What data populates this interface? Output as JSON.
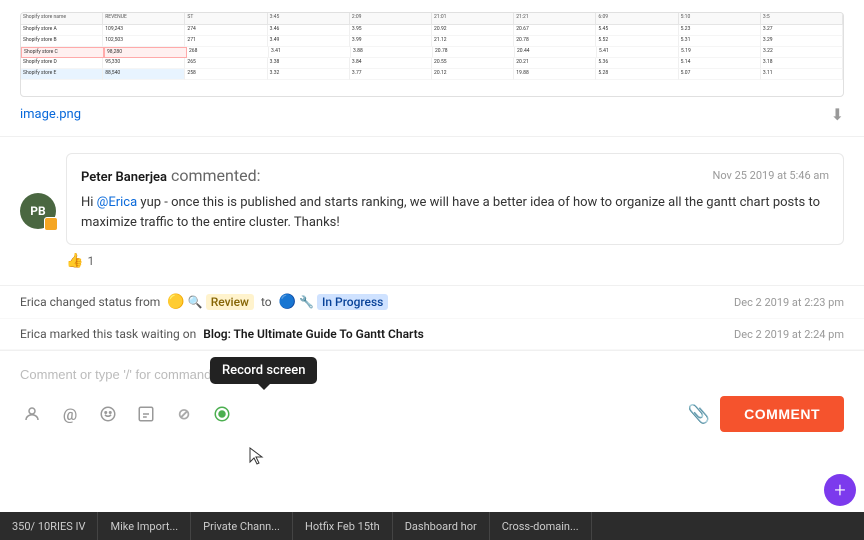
{
  "image": {
    "filename": "image.png",
    "download_label": "⬇"
  },
  "comment": {
    "author": "Peter Banerjea",
    "author_initials": "PB",
    "action": "commented:",
    "timestamp": "Nov 25 2019 at 5:46 am",
    "mention": "@Erica",
    "text_part1": "Hi ",
    "text_part2": " yup - once this is published and starts ranking, we will have a better idea of how to organize all the gantt chart posts to maximize traffic to the entire cluster. Thanks!",
    "likes": "1"
  },
  "activity": [
    {
      "text": "Erica changed status from",
      "from_badge": "Review",
      "arrow": "to",
      "to_badge": "In Progress",
      "timestamp": "Dec 2 2019 at 2:23 pm"
    },
    {
      "text": "Erica marked this task waiting on",
      "link": "Blog: The Ultimate Guide To Gantt Charts",
      "timestamp": "Dec 2 2019 at 2:24 pm"
    }
  ],
  "comment_input": {
    "placeholder": "Comment or type '/' for commands"
  },
  "toolbar": {
    "icons": [
      "person-icon",
      "at-icon",
      "emoji-icon",
      "smile-icon",
      "slash-icon",
      "record-icon"
    ],
    "record_tooltip": "Record screen",
    "comment_button": "COMMENT"
  },
  "taskbar": {
    "items": [
      "350/ 10RIES IV",
      "Mike Import...",
      "Private Chann...",
      "Hotfix Feb 15th",
      "Dashboard hor",
      "Cross-domain..."
    ]
  },
  "fab": "+"
}
